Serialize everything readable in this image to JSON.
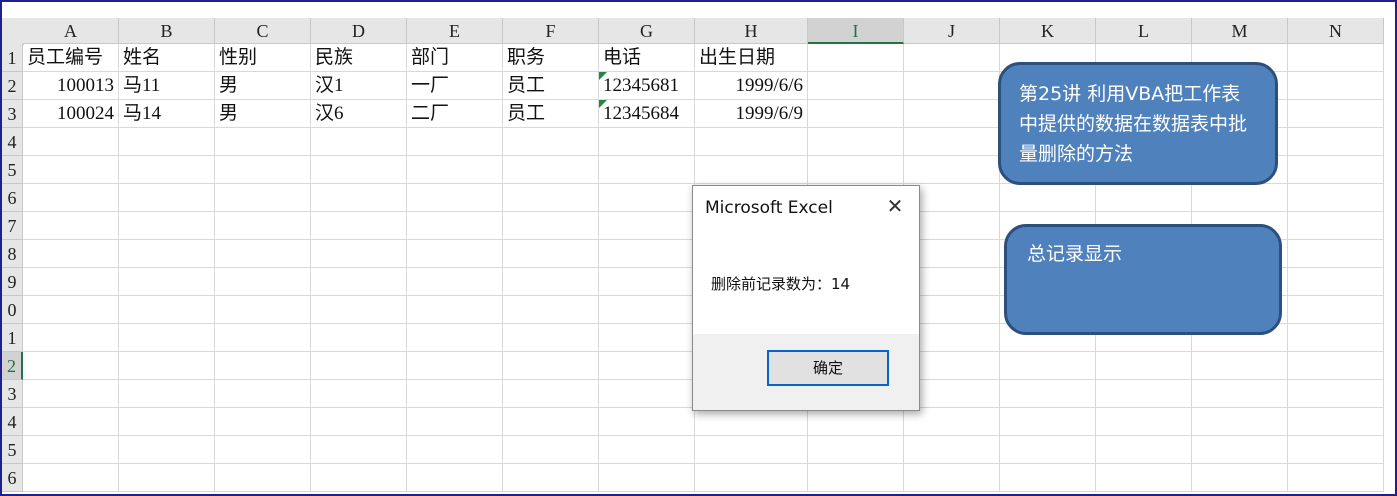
{
  "columns": [
    "A",
    "B",
    "C",
    "D",
    "E",
    "F",
    "G",
    "H",
    "I",
    "J",
    "K",
    "L",
    "M",
    "N"
  ],
  "selected_column": "I",
  "rows": [
    "1",
    "2",
    "3",
    "4",
    "5",
    "6",
    "7",
    "8",
    "9",
    "0",
    "1",
    "2",
    "3",
    "4",
    "5",
    "6"
  ],
  "selected_row_index": 11,
  "sheet": {
    "header": [
      "员工编号",
      "姓名",
      "性别",
      "民族",
      "部门",
      "职务",
      "电话",
      "出生日期"
    ],
    "records": [
      [
        "100013",
        "马11",
        "男",
        "汉1",
        "一厂",
        "员工",
        "12345681",
        "1999/6/6"
      ],
      [
        "100024",
        "马14",
        "男",
        "汉6",
        "二厂",
        "员工",
        "12345684",
        "1999/6/9"
      ]
    ]
  },
  "shapes": {
    "title_box": "第25讲 利用VBA把工作表中提供的数据在数据表中批量删除的方法",
    "total_box": "总记录显示"
  },
  "dialog": {
    "title": "Microsoft Excel",
    "close_glyph": "✕",
    "message": "删除前记录数为：14",
    "ok_label": "确定"
  },
  "colors": {
    "shape_fill": "#4f81bd",
    "shape_border": "#2c4f7c",
    "selection_green": "#217346",
    "error_triangle": "#1e8a3c"
  }
}
